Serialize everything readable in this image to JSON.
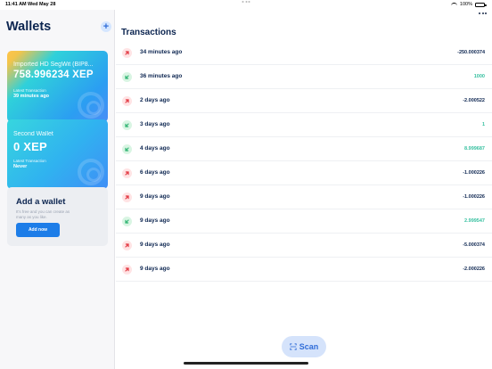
{
  "status_bar": {
    "time": "11:41 AM",
    "date": "Wed May 28",
    "battery": "100%"
  },
  "sidebar": {
    "title": "Wallets",
    "add_icon": "plus-icon",
    "wallets": [
      {
        "name": "Imported HD SegWit (BIP8...",
        "balance": "758.996234 XEP",
        "latest_label": "Latest Transaction",
        "latest_value": "39 minutes ago"
      },
      {
        "name": "Second Wallet",
        "balance": "0 XEP",
        "latest_label": "Latest Transaction",
        "latest_value": "Never"
      }
    ],
    "add_wallet": {
      "title": "Add a wallet",
      "description": "It's free and you can create as many as you like.",
      "button": "Add now"
    }
  },
  "main": {
    "title": "Transactions",
    "transactions": [
      {
        "time": "34 minutes ago",
        "amount": "-250.000374",
        "direction": "out"
      },
      {
        "time": "36 minutes ago",
        "amount": "1000",
        "direction": "in"
      },
      {
        "time": "2 days ago",
        "amount": "-2.000522",
        "direction": "out"
      },
      {
        "time": "3 days ago",
        "amount": "1",
        "direction": "in"
      },
      {
        "time": "4 days ago",
        "amount": "8.999687",
        "direction": "in"
      },
      {
        "time": "6 days ago",
        "amount": "-1.000226",
        "direction": "out"
      },
      {
        "time": "9 days ago",
        "amount": "-1.000226",
        "direction": "out"
      },
      {
        "time": "9 days ago",
        "amount": "2.999547",
        "direction": "in"
      },
      {
        "time": "9 days ago",
        "amount": "-5.000374",
        "direction": "out"
      },
      {
        "time": "9 days ago",
        "amount": "-2.000226",
        "direction": "out"
      }
    ],
    "scan_button": "Scan"
  },
  "colors": {
    "accent": "#1d7de8",
    "outgoing_icon_bg": "#ffe3e4",
    "incoming_icon_bg": "#d9f5e3",
    "incoming_amount": "#37c0a0"
  }
}
